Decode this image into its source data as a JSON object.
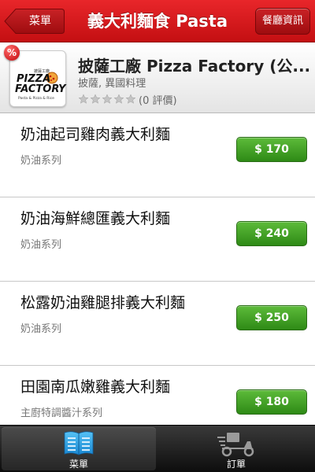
{
  "topbar": {
    "back_label": "菜單",
    "title": "義大利麵食 Pasta",
    "info_label": "餐廳資訊"
  },
  "restaurant": {
    "name": "披薩工廠 Pizza Factory (公...",
    "category": "披薩, 異國料理",
    "rating_text": "(0 評價)",
    "rating_value": 0,
    "rating_max": 5,
    "discount_badge": "%",
    "logo": {
      "text_small": "披薩工廠",
      "text_line1": "PIZZA",
      "text_line2": "FACTORY",
      "tagline": "Pasta & Pizza & Rice"
    }
  },
  "menu_items": [
    {
      "name": "奶油起司雞肉義大利麵",
      "category": "奶油系列",
      "price": "$ 170"
    },
    {
      "name": "奶油海鮮總匯義大利麵",
      "category": "奶油系列",
      "price": "$ 240"
    },
    {
      "name": "松露奶油雞腿排義大利麵",
      "category": "奶油系列",
      "price": "$ 250"
    },
    {
      "name": "田園南瓜嫩雞義大利麵",
      "category": "主廚特調醬汁系列",
      "price": "$ 180"
    }
  ],
  "tabs": [
    {
      "label": "菜單",
      "icon": "menu-book-icon",
      "active": true
    },
    {
      "label": "訂單",
      "icon": "delivery-scooter-icon",
      "active": false
    }
  ],
  "colors": {
    "topbar_red": "#d81a1e",
    "price_green": "#3f9e22",
    "tab_active_blue": "#2aa6e8"
  }
}
